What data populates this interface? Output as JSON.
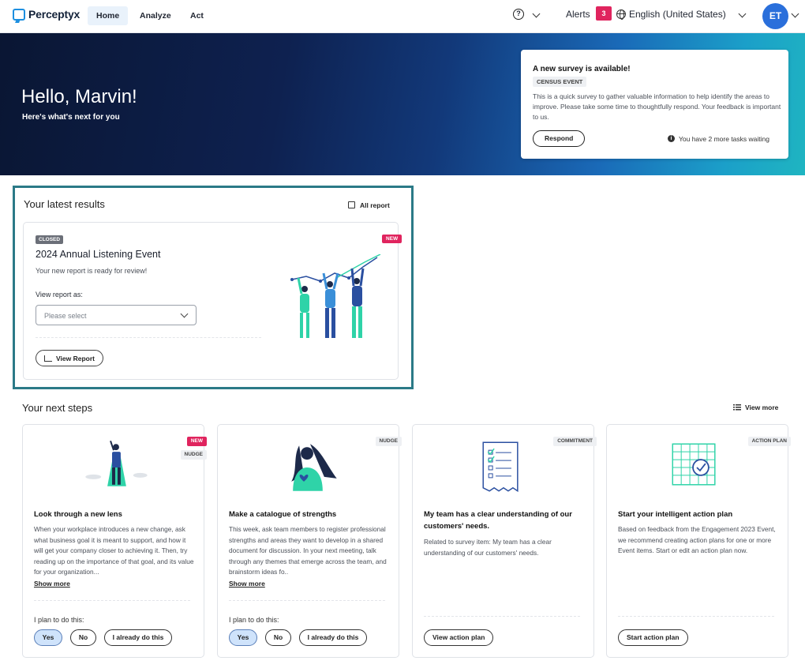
{
  "app": {
    "brand": "Perceptyx"
  },
  "nav": {
    "tabs": [
      {
        "label": "Home"
      },
      {
        "label": "Analyze"
      },
      {
        "label": "Act"
      }
    ],
    "help_glyph": "?",
    "alerts_label": "Alerts",
    "alerts_count": "3",
    "language": "English (United States)",
    "avatar_initials": "ET"
  },
  "hero": {
    "greeting": "Hello, Marvin!",
    "subtitle": "Here's what's next for you",
    "survey_card": {
      "title": "A new survey is available!",
      "tag": "CENSUS EVENT",
      "description": "This is a quick survey to gather valuable information to help identify the areas to improve. Please take some time to thoughtfully respond. Your feedback is important to us.",
      "respond_label": "Respond",
      "info_glyph": "i",
      "tasks_note": "You have 2 more tasks waiting"
    }
  },
  "results": {
    "title": "Your latest results",
    "all_report_label": "All report",
    "card": {
      "status_badge": "CLOSED",
      "new_badge": "NEW",
      "event_name": "2024 Annual Listening Event",
      "ready_text": "Your new report is ready for review!",
      "view_as_label": "View report as:",
      "select_placeholder": "Please select",
      "view_report_label": "View Report"
    }
  },
  "next_steps": {
    "title": "Your next steps",
    "view_more_label": "View more",
    "cards": [
      {
        "tags": [
          "NEW",
          "NUDGE"
        ],
        "title": "Look through a new lens",
        "description": "When your workplace introduces a new change, ask what business goal it is meant to support, and how it will get your company closer to achieving it. Then, try reading up on the importance of that goal, and its value for your organization...",
        "show_more": "Show more",
        "plan_label": "I plan to do this:",
        "options": [
          "Yes",
          "No",
          "I already do this"
        ]
      },
      {
        "tags": [
          "NUDGE"
        ],
        "title": "Make a catalogue of strengths",
        "description": "This week, ask team members to register professional strengths and areas they want to develop in a shared document for discussion. In your next meeting, talk through any themes that emerge across the team, and brainstorm ideas fo..",
        "show_more": "Show more",
        "plan_label": "I plan to do this:",
        "options": [
          "Yes",
          "No",
          "I already do this"
        ]
      },
      {
        "tags": [
          "COMMITMENT"
        ],
        "title": "My team has a clear understanding of our customers' needs.",
        "description": "Related to survey item: My team has a clear understanding of our customers' needs.",
        "action_label": "View action plan"
      },
      {
        "tags": [
          "ACTION PLAN"
        ],
        "title": "Start your intelligent action plan",
        "description": "Based on feedback from the Engagement 2023 Event, we recommend creating action plans for one or more Event items. Start or edit an action plan now.",
        "action_label": "Start action plan"
      }
    ]
  },
  "colors": {
    "accent_pink": "#e0245e",
    "brand_blue": "#2a6fdb",
    "highlight_border": "#2b7a87",
    "illustration_teal": "#2fd3a8",
    "selected_pill": "#cfe3fb"
  }
}
